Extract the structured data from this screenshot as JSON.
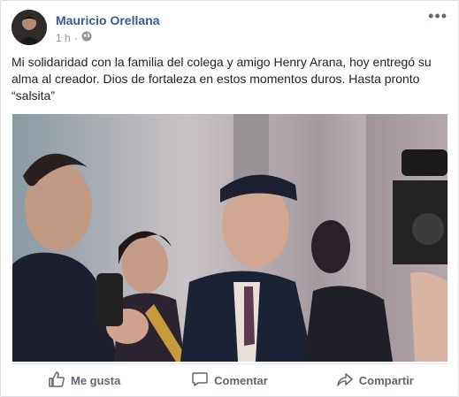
{
  "post": {
    "author": "Mauricio Orellana",
    "time": "1 h",
    "separator": "·",
    "text": "Mi solidaridad con la familia del colega y amigo Henry Arana, hoy entregó su alma al creador. Dios de fortaleza en estos momentos duros. Hasta pronto “salsita”",
    "more_label": "•••"
  },
  "actions": {
    "like": "Me gusta",
    "comment": "Comentar",
    "share": "Compartir"
  },
  "colors": {
    "author_link": "#365899",
    "action_text": "#606770"
  },
  "icons": {
    "privacy": "globe-icon",
    "like": "thumbs-up-icon",
    "comment": "comment-icon",
    "share": "share-icon",
    "more": "more-options-icon"
  }
}
